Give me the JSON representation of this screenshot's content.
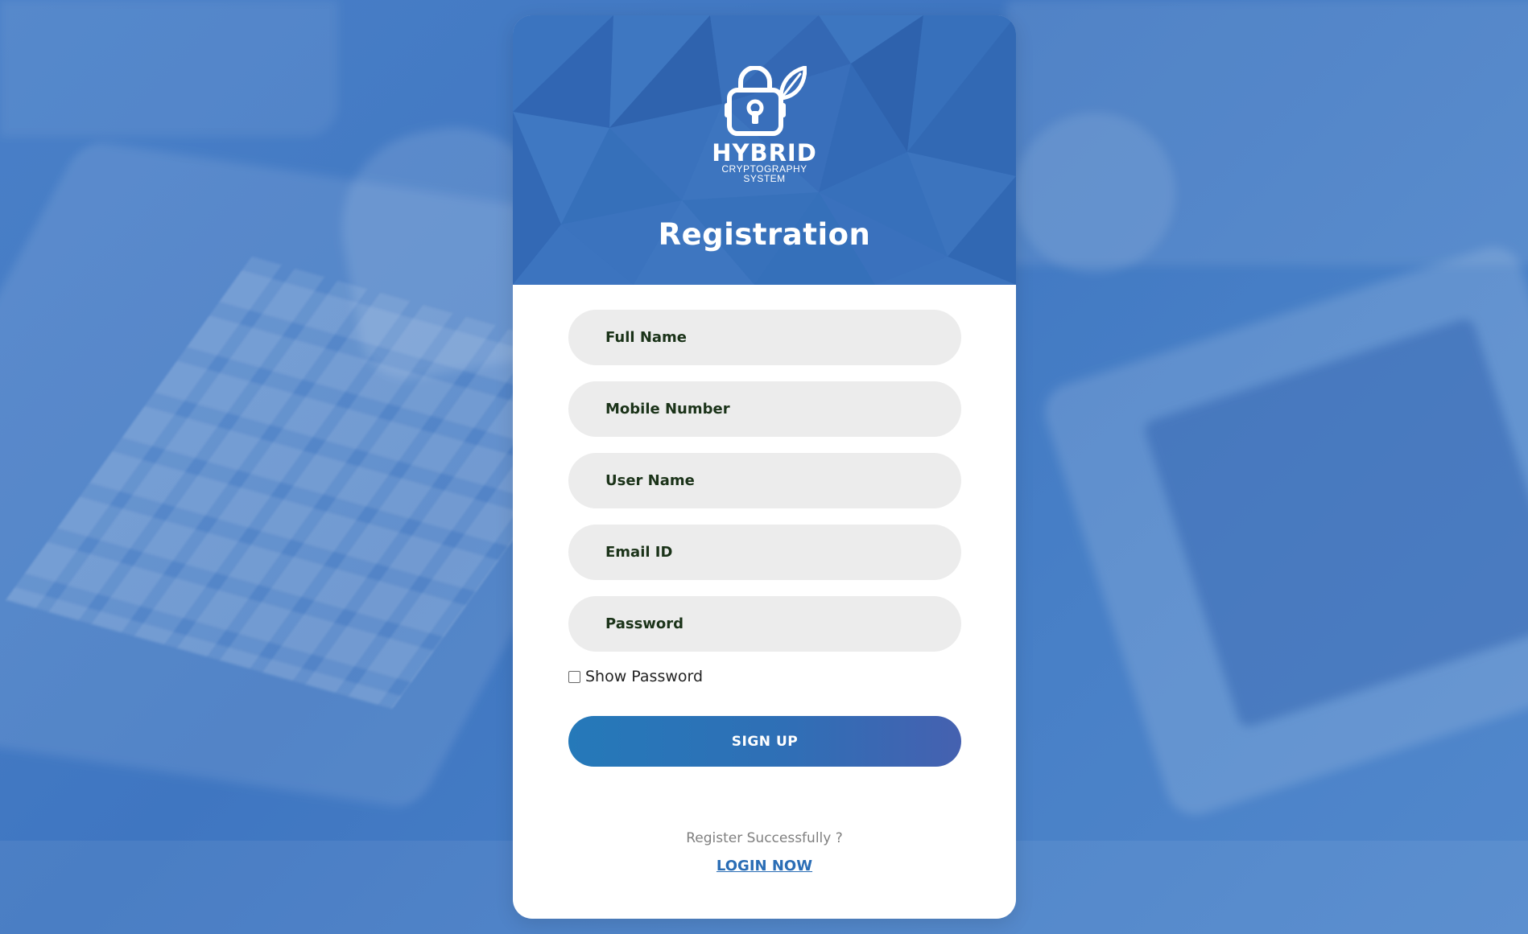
{
  "brand": {
    "name": "HYBRID",
    "subtitle_line1": "CRYPTOGRAPHY",
    "subtitle_line2": "SYSTEM",
    "logo_icon": "lock-leaf-icon"
  },
  "page": {
    "title": "Registration"
  },
  "form": {
    "full_name": {
      "placeholder": "Full Name",
      "value": ""
    },
    "mobile": {
      "placeholder": "Mobile Number",
      "value": ""
    },
    "username": {
      "placeholder": "User Name",
      "value": ""
    },
    "email": {
      "placeholder": "Email ID",
      "value": ""
    },
    "password": {
      "placeholder": "Password",
      "value": ""
    },
    "show_password_label": "Show Password",
    "show_password_checked": false,
    "submit_label": "SIGN UP"
  },
  "footer": {
    "question": "Register Successfully ?",
    "login_link": "LOGIN NOW"
  },
  "colors": {
    "header_blue": "#3a72bd",
    "button_start": "#2579b9",
    "button_end": "#4561b0",
    "link": "#2a6db5",
    "field_bg": "#ececec"
  }
}
